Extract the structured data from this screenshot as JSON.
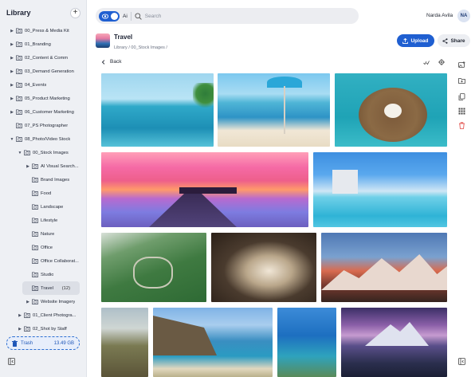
{
  "sidebar": {
    "title": "Library",
    "add_icon": "plus-icon",
    "items": [
      {
        "label": "00_Press & Media Kit",
        "depth": 0,
        "arrow": "right"
      },
      {
        "label": "01_Branding",
        "depth": 0,
        "arrow": "right"
      },
      {
        "label": "02_Content & Comm",
        "depth": 0,
        "arrow": "right"
      },
      {
        "label": "03_Demand Generation",
        "depth": 0,
        "arrow": "right"
      },
      {
        "label": "04_Events",
        "depth": 0,
        "arrow": "right"
      },
      {
        "label": "05_Product Marketing",
        "depth": 0,
        "arrow": "right"
      },
      {
        "label": "06_Customer Marketing",
        "depth": 0,
        "arrow": "right"
      },
      {
        "label": "07_PS Photographer",
        "depth": 0,
        "arrow": "none"
      },
      {
        "label": "08_Photo/Video Stock",
        "depth": 0,
        "arrow": "down"
      },
      {
        "label": "00_Stock Images",
        "depth": 1,
        "arrow": "down"
      },
      {
        "label": "AI Visual Search...",
        "depth": 2,
        "arrow": "right"
      },
      {
        "label": "Brand Images",
        "depth": 2,
        "arrow": "none"
      },
      {
        "label": "Food",
        "depth": 2,
        "arrow": "none"
      },
      {
        "label": "Landscape",
        "depth": 2,
        "arrow": "none"
      },
      {
        "label": "Lifestyle",
        "depth": 2,
        "arrow": "none"
      },
      {
        "label": "Nature",
        "depth": 2,
        "arrow": "none"
      },
      {
        "label": "Office",
        "depth": 2,
        "arrow": "none"
      },
      {
        "label": "Office Collaborat...",
        "depth": 2,
        "arrow": "none"
      },
      {
        "label": "Studio",
        "depth": 2,
        "arrow": "none"
      },
      {
        "label": "Travel",
        "depth": 2,
        "arrow": "none",
        "count": "(12)",
        "selected": true
      },
      {
        "label": "Website Imagery",
        "depth": 2,
        "arrow": "right"
      },
      {
        "label": "01_Client Photogra...",
        "depth": 1,
        "arrow": "right"
      },
      {
        "label": "02_Shot by Staff",
        "depth": 1,
        "arrow": "right"
      }
    ],
    "trash": {
      "label": "Trash",
      "size": "13.49 GB"
    }
  },
  "search": {
    "ai_label": "Ai",
    "placeholder": "Search",
    "value": ""
  },
  "user": {
    "name": "Narda Avila",
    "initials": "NA"
  },
  "header": {
    "title": "Travel",
    "breadcrumb": "Library /  00_Stock Images  /",
    "upload_label": "Upload",
    "share_label": "Share"
  },
  "toolbar": {
    "back_label": "Back"
  },
  "right_rail_icons": [
    "image-add-icon",
    "folder-add-icon",
    "copy-icon",
    "grid-dots-icon",
    "trash-icon"
  ],
  "colors": {
    "accent": "#1f5fd1",
    "danger": "#e0413d",
    "sidebar_bg": "#eef0f4"
  },
  "images": [
    {
      "name": "infinity-pool-couple"
    },
    {
      "name": "beach-umbrella-loungers"
    },
    {
      "name": "woman-in-hat-hammock"
    },
    {
      "name": "pier-sunset-huts"
    },
    {
      "name": "resort-infinity-pool"
    },
    {
      "name": "winding-mountain-road"
    },
    {
      "name": "sea-cave-beach"
    },
    {
      "name": "snowy-mountain-peaks"
    },
    {
      "name": "green-hills"
    },
    {
      "name": "coastal-cliffs"
    },
    {
      "name": "tropical-bay-aerial"
    },
    {
      "name": "mountain-lake-night"
    }
  ]
}
